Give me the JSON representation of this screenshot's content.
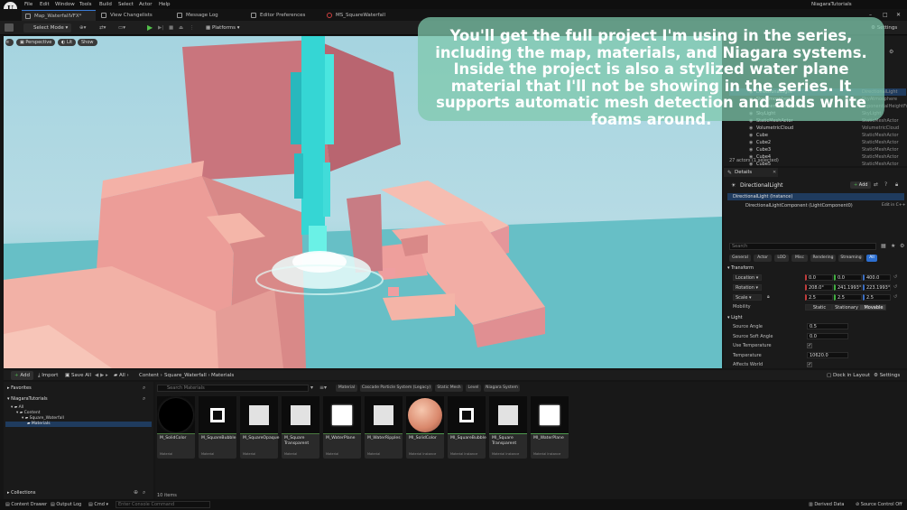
{
  "menubar": {
    "project": "NiagaraTutorials",
    "items": [
      "File",
      "Edit",
      "Window",
      "Tools",
      "Build",
      "Select",
      "Actor",
      "Help"
    ]
  },
  "tabs": [
    {
      "label": "Map_WaterfallVFX*"
    },
    {
      "label": "View Changelists"
    },
    {
      "label": "Message Log"
    },
    {
      "label": "Editor Preferences"
    },
    {
      "label": "MS_SquareWaterfall"
    }
  ],
  "toolbar": {
    "select_mode": "Select Mode",
    "platforms": "Platforms",
    "settings": "Settings"
  },
  "viewport": {
    "perspective": "Perspective",
    "lit": "Lit",
    "show": "Show"
  },
  "overlay_text": "You'll get the full project I'm using in the series, including the map, materials, and Niagara systems. Inside the project is also a stylized water plane material that I'll not be showing in the series. It supports automatic mesh detection and adds white foams around.",
  "outliner": {
    "rows": [
      {
        "name": "DirectionalLight",
        "type": "DirectionalLight"
      },
      {
        "name": "SkyAtmosphere",
        "type": "SkyAtmosphere"
      },
      {
        "name": "ExponentialHeightFog",
        "type": "ExponentialHeightFog"
      },
      {
        "name": "SkyLight",
        "type": "SkyLight"
      },
      {
        "name": "StaticMeshActor",
        "type": "StaticMeshActor"
      },
      {
        "name": "VolumetricCloud",
        "type": "VolumetricCloud"
      },
      {
        "name": "Cube",
        "type": "StaticMeshActor"
      },
      {
        "name": "Cube2",
        "type": "StaticMeshActor"
      },
      {
        "name": "Cube3",
        "type": "StaticMeshActor"
      },
      {
        "name": "Cube4",
        "type": "StaticMeshActor"
      },
      {
        "name": "Cube5",
        "type": "StaticMeshActor"
      }
    ],
    "footer": "27 actors (1 selected)"
  },
  "details": {
    "tab": "Details",
    "actor": "DirectionalLight",
    "add": "Add",
    "instance": "DirectionalLight (Instance)",
    "component": "DirectionalLightComponent (LightComponent0)",
    "edit_cpp": "Edit in C++",
    "search_placeholder": "Search",
    "filters": [
      "General",
      "Actor",
      "LOD",
      "Misc",
      "Rendering",
      "Streaming",
      "All"
    ],
    "transform_header": "Transform",
    "location_label": "Location",
    "rotation_label": "Rotation",
    "scale_label": "Scale",
    "mobility_label": "Mobility",
    "location": [
      "0.0",
      "0.0",
      "400.0"
    ],
    "rotation": [
      "208.0°",
      "241.1993°",
      "223.1993°"
    ],
    "scale": [
      "2.5",
      "2.5",
      "2.5"
    ],
    "mobility_options": [
      "Static",
      "Stationary",
      "Movable"
    ],
    "light_header": "Light",
    "source_angle_label": "Source Angle",
    "source_angle": "0.5",
    "source_soft_angle_label": "Source Soft Angle",
    "source_soft_angle": "0.0",
    "use_temperature_label": "Use Temperature",
    "temperature_label": "Temperature",
    "temperature": "10620.0",
    "affects_world_label": "Affects World"
  },
  "content_browser": {
    "add": "Add",
    "import": "Import",
    "save_all": "Save All",
    "all": "All",
    "path": [
      "Content",
      "Square_Waterfall",
      "Materials"
    ],
    "dock": "Dock in Layout",
    "settings": "Settings",
    "favorites": "Favorites",
    "project": "NiagaraTutorials",
    "tree": [
      "All",
      "Content",
      "Square_Waterfall",
      "Materials"
    ],
    "collections": "Collections",
    "search_placeholder": "Search Materials",
    "filter_chips": [
      "Material",
      "Cascade Particle System (Legacy)",
      "Static Mesh",
      "Level",
      "Niagara System"
    ],
    "item_count": "10 items",
    "assets": [
      {
        "name": "M_SolidColor",
        "type": "Material"
      },
      {
        "name": "M_SquareBubble",
        "type": "Material"
      },
      {
        "name": "M_SquareOpaque",
        "type": "Material"
      },
      {
        "name": "M_Square Transparent",
        "type": "Material"
      },
      {
        "name": "M_WaterPlane",
        "type": "Material"
      },
      {
        "name": "M_WaterRipples",
        "type": "Material"
      },
      {
        "name": "MI_SolidColor",
        "type": "Material Instance"
      },
      {
        "name": "MI_SquareBubble",
        "type": "Material Instance"
      },
      {
        "name": "MI_Square Transparent",
        "type": "Material Instance"
      },
      {
        "name": "MI_WaterPlane",
        "type": "Material Instance"
      }
    ]
  },
  "statusbar": {
    "content_drawer": "Content Drawer",
    "output_log": "Output Log",
    "cmd": "Cmd",
    "console_placeholder": "Enter Console Command",
    "derived_data": "Derived Data",
    "source_control": "Source Control Off"
  }
}
